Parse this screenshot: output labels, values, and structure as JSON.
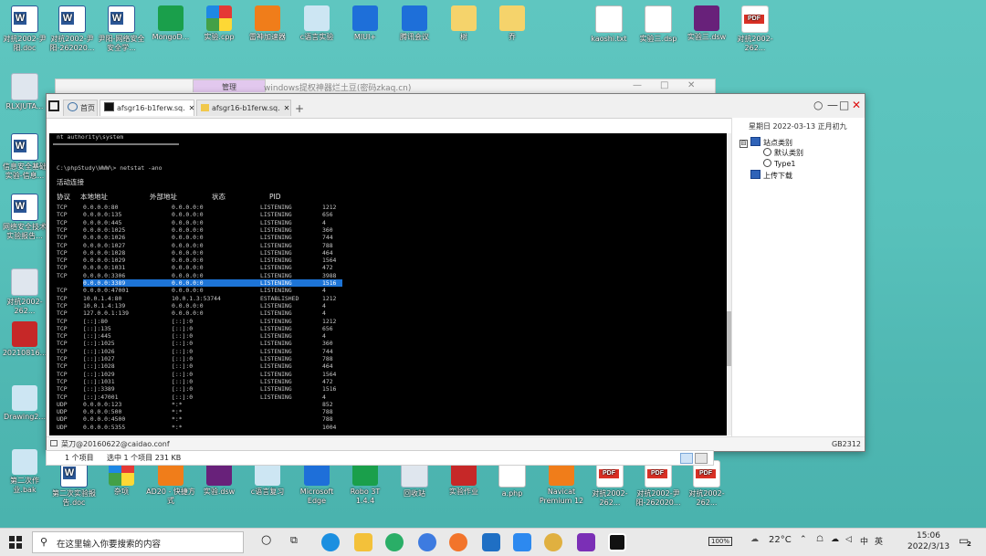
{
  "desktop": {
    "top_icons": [
      {
        "label": "对抗2002-尹阳.doc",
        "kind": "word"
      },
      {
        "label": "对抗2002-尹阳-262020...",
        "kind": "word"
      },
      {
        "label": "尹阳-网络安全安全学...",
        "kind": "word"
      },
      {
        "label": "MongoD...",
        "kind": "green"
      },
      {
        "label": "实验.cpp",
        "kind": "multi"
      },
      {
        "label": "雷神加速器",
        "kind": "orange"
      },
      {
        "label": "c语言实验",
        "kind": "paper"
      },
      {
        "label": "MIUI+",
        "kind": "blue"
      },
      {
        "label": "腾讯会议",
        "kind": "blue"
      },
      {
        "label": "树",
        "kind": "folder"
      },
      {
        "label": "乔",
        "kind": "folder"
      },
      {
        "label": "kaoshi.txt",
        "kind": "txt"
      },
      {
        "label": "实验三.dsp",
        "kind": "txt"
      },
      {
        "label": "实验三.dsw",
        "kind": "vs"
      },
      {
        "label": "对抗2002-262...",
        "kind": "pdf"
      }
    ],
    "left_icons": [
      {
        "label": "RLXJUTA...",
        "kind": "gray"
      },
      {
        "label": "信息安全基础实验-信息...",
        "kind": "word"
      },
      {
        "label": "网络安全技术实验报告...",
        "kind": "word"
      },
      {
        "label": "对抗2002-262...",
        "kind": "gray"
      },
      {
        "label": "20210816...",
        "kind": "red"
      },
      {
        "label": "Drawing2...",
        "kind": "paper"
      },
      {
        "label": "第二次作业.bak",
        "kind": "paper"
      }
    ],
    "bottom_icons": [
      {
        "label": "第二次实验报告.doc",
        "kind": "word"
      },
      {
        "label": "杂项",
        "kind": "multi"
      },
      {
        "label": "AD20 - 快捷方式",
        "kind": "orange"
      },
      {
        "label": "实验.dsw",
        "kind": "vs"
      },
      {
        "label": "c语言复习",
        "kind": "paper"
      },
      {
        "label": "Microsoft Edge",
        "kind": "blue"
      },
      {
        "label": "Robo 3T 1.4.4",
        "kind": "green"
      },
      {
        "label": "回收站",
        "kind": "gray"
      },
      {
        "label": "实验作业",
        "kind": "red"
      },
      {
        "label": "a.php",
        "kind": "txt"
      },
      {
        "label": "Navicat Premium 12",
        "kind": "orange"
      },
      {
        "label": "对抗2002-262...",
        "kind": "pdf"
      },
      {
        "label": "对抗2002-尹阳-262020...",
        "kind": "pdf"
      },
      {
        "label": "对抗2002-262...",
        "kind": "pdf"
      }
    ]
  },
  "back_window": {
    "title": "windows提权神器烂土豆(密码zkaq.cn)",
    "tab": "管理"
  },
  "main_window": {
    "tabs": [
      {
        "label": "首页",
        "icon": "home-icon",
        "active": false
      },
      {
        "label": "afsgr16-b1ferw.sq.",
        "icon": "terminal-icon",
        "active": true
      },
      {
        "label": "afsgr16-b1ferw.sq.",
        "icon": "folder-icon",
        "active": false
      }
    ],
    "add_tab": "+",
    "controls": {
      "restore": "○",
      "minimize": "—",
      "maximize": "□",
      "close": "✕"
    },
    "terminal": {
      "whoami": "nt authority\\system",
      "prompt": "C:\\phpStudy\\WWW\\> netstat -ano",
      "section_title": "活动连接",
      "headers": [
        "协议",
        "本地地址",
        "外部地址",
        "状态",
        "PID"
      ],
      "rows": [
        [
          "TCP",
          "0.0.0.0:80",
          "0.0.0.0:0",
          "LISTENING",
          "1212"
        ],
        [
          "TCP",
          "0.0.0.0:135",
          "0.0.0.0:0",
          "LISTENING",
          "656"
        ],
        [
          "TCP",
          "0.0.0.0:445",
          "0.0.0.0:0",
          "LISTENING",
          "4"
        ],
        [
          "TCP",
          "0.0.0.0:1025",
          "0.0.0.0:0",
          "LISTENING",
          "360"
        ],
        [
          "TCP",
          "0.0.0.0:1026",
          "0.0.0.0:0",
          "LISTENING",
          "744"
        ],
        [
          "TCP",
          "0.0.0.0:1027",
          "0.0.0.0:0",
          "LISTENING",
          "788"
        ],
        [
          "TCP",
          "0.0.0.0:1028",
          "0.0.0.0:0",
          "LISTENING",
          "464"
        ],
        [
          "TCP",
          "0.0.0.0:1029",
          "0.0.0.0:0",
          "LISTENING",
          "1564"
        ],
        [
          "TCP",
          "0.0.0.0:1031",
          "0.0.0.0:0",
          "LISTENING",
          "472"
        ],
        [
          "TCP",
          "0.0.0.0:3306",
          "0.0.0.0:0",
          "LISTENING",
          "3988"
        ],
        [
          "TCP",
          "0.0.0.0:3389",
          "0.0.0.0:0",
          "LISTENING",
          "1516"
        ],
        [
          "TCP",
          "0.0.0.0:47001",
          "0.0.0.0:0",
          "LISTENING",
          "4"
        ],
        [
          "TCP",
          "10.0.1.4:80",
          "10.0.1.3:53744",
          "ESTABLISHED",
          "1212"
        ],
        [
          "TCP",
          "10.0.1.4:139",
          "0.0.0.0:0",
          "LISTENING",
          "4"
        ],
        [
          "TCP",
          "127.0.0.1:139",
          "0.0.0.0:0",
          "LISTENING",
          "4"
        ],
        [
          "TCP",
          "[::]:80",
          "[::]:0",
          "LISTENING",
          "1212"
        ],
        [
          "TCP",
          "[::]:135",
          "[::]:0",
          "LISTENING",
          "656"
        ],
        [
          "TCP",
          "[::]:445",
          "[::]:0",
          "LISTENING",
          "4"
        ],
        [
          "TCP",
          "[::]:1025",
          "[::]:0",
          "LISTENING",
          "360"
        ],
        [
          "TCP",
          "[::]:1026",
          "[::]:0",
          "LISTENING",
          "744"
        ],
        [
          "TCP",
          "[::]:1027",
          "[::]:0",
          "LISTENING",
          "788"
        ],
        [
          "TCP",
          "[::]:1028",
          "[::]:0",
          "LISTENING",
          "464"
        ],
        [
          "TCP",
          "[::]:1029",
          "[::]:0",
          "LISTENING",
          "1564"
        ],
        [
          "TCP",
          "[::]:1031",
          "[::]:0",
          "LISTENING",
          "472"
        ],
        [
          "TCP",
          "[::]:3389",
          "[::]:0",
          "LISTENING",
          "1516"
        ],
        [
          "TCP",
          "[::]:47001",
          "[::]:0",
          "LISTENING",
          "4"
        ],
        [
          "UDP",
          "0.0.0.0:123",
          "*:*",
          "",
          "852"
        ],
        [
          "UDP",
          "0.0.0.0:500",
          "*:*",
          "",
          "788"
        ],
        [
          "UDP",
          "0.0.0.0:4500",
          "*:*",
          "",
          "788"
        ],
        [
          "UDP",
          "0.0.0.0:5355",
          "*:*",
          "",
          "1004"
        ]
      ],
      "selected_row_index": 10
    },
    "side_panel": {
      "date": "星期日  2022-03-13  正月初九",
      "tree": [
        {
          "label": "站点类别",
          "level": 0,
          "expander": "⊟",
          "kind": "folder"
        },
        {
          "label": "默认类别",
          "level": 1,
          "kind": "circle"
        },
        {
          "label": "Type1",
          "level": 1,
          "kind": "circle"
        },
        {
          "label": "上传下载",
          "level": 0,
          "kind": "folder"
        }
      ]
    },
    "status_left": "菜刀@20160622@caidao.conf",
    "status_right": "GB2312"
  },
  "explorer_status": {
    "count": "1 个项目",
    "selected": "选中 1 个项目  231 KB"
  },
  "taskbar": {
    "search_placeholder": "在这里输入你要搜索的内容",
    "battery": "100%",
    "temperature": "22°C",
    "ime": "英",
    "time": "15:06",
    "date": "2022/3/13",
    "notifications": "2"
  }
}
